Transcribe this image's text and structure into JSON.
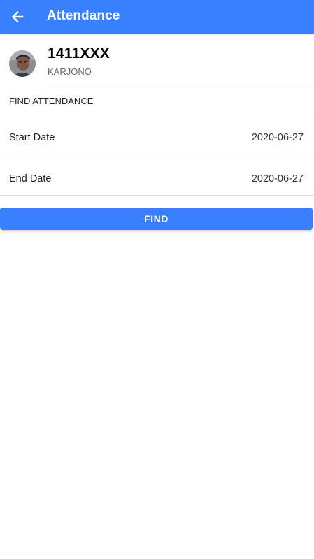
{
  "toolbar": {
    "title": "Attendance",
    "back_icon": "arrow-left-icon"
  },
  "profile": {
    "id": "1411XXX",
    "name": "KARJONO"
  },
  "section": {
    "title": "FIND ATTENDANCE"
  },
  "fields": {
    "start_label": "Start Date",
    "start_value": "2020-06-27",
    "end_label": "End Date",
    "end_value": "2020-06-27"
  },
  "actions": {
    "find_label": "FIND"
  },
  "colors": {
    "primary": "#3880ff",
    "divider": "#dedede"
  }
}
